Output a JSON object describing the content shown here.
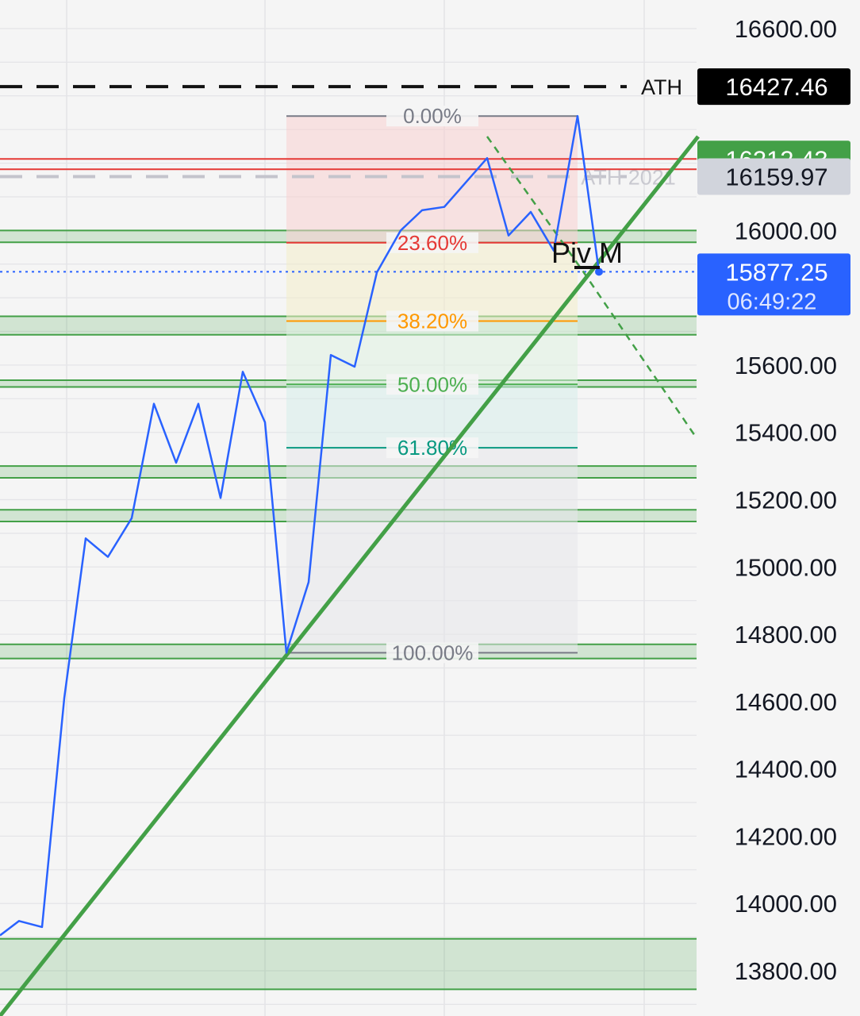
{
  "chart_data": {
    "type": "line",
    "y_scale": "linear",
    "ylim": [
      13700,
      16700
    ],
    "grid": true,
    "y_ticks": [
      {
        "v": 16600,
        "label": "16600.00"
      },
      {
        "v": 16000,
        "label": "16000.00"
      },
      {
        "v": 15600,
        "label": "15600.00"
      },
      {
        "v": 15400,
        "label": "15400.00"
      },
      {
        "v": 15200,
        "label": "15200.00"
      },
      {
        "v": 15000,
        "label": "15000.00"
      },
      {
        "v": 14800,
        "label": "14800.00"
      },
      {
        "v": 14600,
        "label": "14600.00"
      },
      {
        "v": 14400,
        "label": "14400.00"
      },
      {
        "v": 14200,
        "label": "14200.00"
      },
      {
        "v": 14000,
        "label": "14000.00"
      },
      {
        "v": 13800,
        "label": "13800.00"
      }
    ],
    "series": [
      {
        "color": "#2962ff",
        "values": [
          13905,
          13948,
          13930,
          14610,
          15085,
          15030,
          15145,
          15485,
          15310,
          15485,
          15205,
          15580,
          15430,
          14745,
          14955,
          15630,
          15595,
          15875,
          16000,
          16060,
          16070,
          16215,
          15985,
          16055,
          15940,
          16340,
          15877.25
        ]
      }
    ],
    "price_labels": [
      {
        "v": 16427.46,
        "label": "16427.46",
        "bg": "#000000",
        "fg": "#ffffff",
        "caption": "ATH"
      },
      {
        "v": 16212.43,
        "label": "16212.43",
        "bg": "#43a047",
        "fg": "#ffffff"
      },
      {
        "v": 16159.97,
        "label": "16159.97",
        "bg": "#d1d4dc",
        "fg": "#131722"
      },
      {
        "v": 15877.25,
        "label": "15877.25",
        "sub": "06:49:22",
        "bg": "#2962ff",
        "fg": "#ffffff"
      }
    ],
    "horizontal_lines": [
      {
        "v": 16427.46,
        "style": "dashed",
        "color": "#111111"
      },
      {
        "v": 16159.97,
        "style": "dashed",
        "color": "#c4c4cc",
        "label": "ATH 2021"
      },
      {
        "v": 16212.43,
        "style": "solid",
        "color": "#e53935"
      },
      {
        "v": 16182,
        "style": "solid",
        "color": "#e53935"
      },
      {
        "v": 15877.25,
        "style": "dotted",
        "color": "#2962ff"
      }
    ],
    "zones": [
      {
        "from": 16000,
        "to": 15965,
        "color": "#43a047"
      },
      {
        "from": 15745,
        "to": 15690,
        "color": "#43a047"
      },
      {
        "from": 15555,
        "to": 15535,
        "color": "#43a047"
      },
      {
        "from": 15300,
        "to": 15265,
        "color": "#43a047"
      },
      {
        "from": 15170,
        "to": 15135,
        "color": "#43a047"
      },
      {
        "from": 14770,
        "to": 14728,
        "color": "#43a047"
      },
      {
        "from": 13895,
        "to": 13745,
        "color": "#43a047"
      }
    ],
    "fibonacci": {
      "high": 16340,
      "low": 14745,
      "levels": [
        {
          "label": "0.00%",
          "ratio": 0.0,
          "color": "#787b86"
        },
        {
          "label": "23.60%",
          "ratio": 0.236,
          "color": "#e53935"
        },
        {
          "label": "38.20%",
          "ratio": 0.382,
          "color": "#ff9800"
        },
        {
          "label": "50.00%",
          "ratio": 0.5,
          "color": "#4caf50"
        },
        {
          "label": "61.80%",
          "ratio": 0.618,
          "color": "#089981"
        },
        {
          "label": "100.00%",
          "ratio": 1.0,
          "color": "#787b86"
        }
      ]
    },
    "annotations": [
      {
        "text": "Piv M",
        "v": 15975
      }
    ],
    "colors": {
      "background": "#f5f5f5",
      "price_line": "#2962ff",
      "trendline": "#43a047"
    }
  }
}
